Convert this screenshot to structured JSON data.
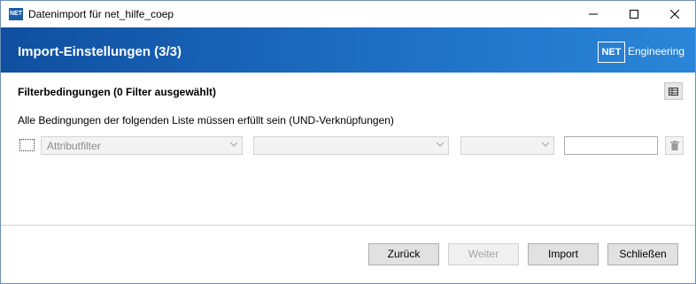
{
  "window": {
    "title": "Datenimport für net_hilfe_coep",
    "app_icon_text": "NET"
  },
  "header": {
    "title": "Import-Einstellungen (3/3)",
    "logo_box": "NET",
    "logo_text": "Engineering"
  },
  "filter": {
    "title": "Filterbedingungen (0 Filter ausgewählt)",
    "description": "Alle Bedingungen der folgenden Liste müssen erfüllt sein (UND-Verknüpfungen)",
    "row": {
      "attribute_value": "Attributfilter",
      "operator_value": "",
      "comparison_value": "",
      "text_value": ""
    }
  },
  "buttons": {
    "back": "Zurück",
    "next": "Weiter",
    "import": "Import",
    "close": "Schließen"
  },
  "colors": {
    "header_start": "#0f4fa0",
    "header_end": "#2a86d8"
  }
}
